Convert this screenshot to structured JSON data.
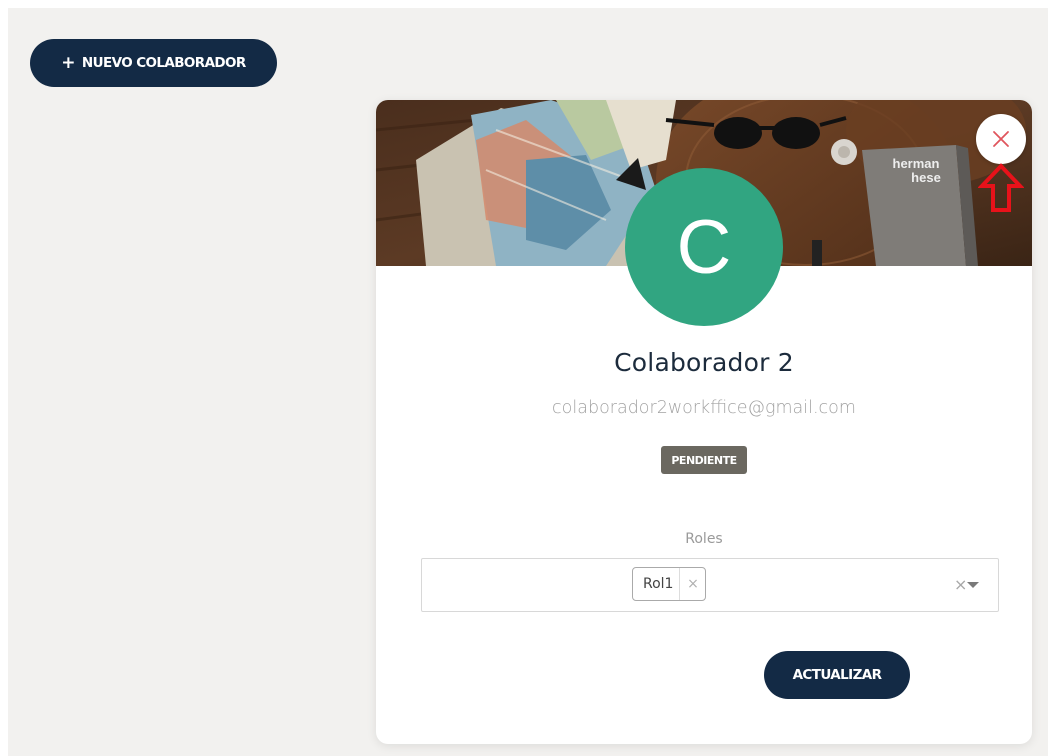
{
  "toolbar": {
    "new_collaborator_label": "NUEVO COLABORADOR"
  },
  "profile": {
    "avatar_initial": "C",
    "name": "Colaborador 2",
    "email": "colaborador2workffice@gmail.com",
    "status": "PENDIENTE",
    "avatar_color": "#31a581"
  },
  "roles": {
    "label": "Roles",
    "selected": [
      "Rol1"
    ]
  },
  "actions": {
    "update_label": "ACTUALIZAR"
  },
  "cover_book": {
    "title_line1": "herman",
    "title_line2": "hese"
  },
  "colors": {
    "primary": "#132a45",
    "close_icon": "#e0555d",
    "annotation_arrow": "#e8121a",
    "badge": "#6b6860"
  },
  "icons": {
    "plus": "plus-icon",
    "close": "close-icon",
    "tag_remove": "close-icon",
    "clear": "clear-icon",
    "dropdown": "caret-down-icon",
    "annotation": "arrow-up-icon"
  }
}
